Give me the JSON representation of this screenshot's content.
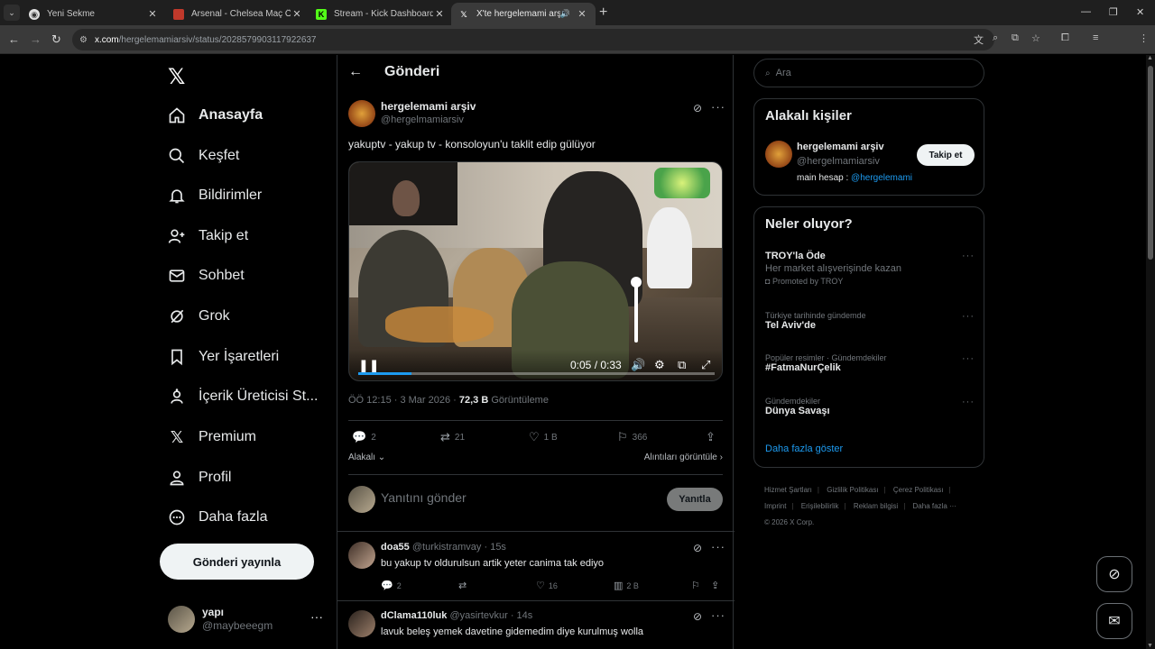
{
  "browser": {
    "tabs": [
      {
        "title": "Yeni Sekme",
        "favicon": "chrome-icon",
        "active": false
      },
      {
        "title": "Arsenal - Chelsea Maç Özeti (Vi",
        "favicon": "video-site-icon",
        "active": false
      },
      {
        "title": "Stream - Kick Dashboard",
        "favicon": "kick-icon",
        "active": false
      },
      {
        "title": "X'te hergelemami arşiv: \"yal",
        "favicon": "x-icon",
        "active": true
      }
    ],
    "url_host": "x.com",
    "url_path": "/hergelemamiarsiv/status/2028579903117922637",
    "profile_color": "#e37400"
  },
  "nav": {
    "items": [
      {
        "label": "Anasayfa",
        "icon": "home-icon"
      },
      {
        "label": "Keşfet",
        "icon": "search-icon"
      },
      {
        "label": "Bildirimler",
        "icon": "bell-icon"
      },
      {
        "label": "Takip et",
        "icon": "person-add-icon"
      },
      {
        "label": "Sohbet",
        "icon": "mail-icon"
      },
      {
        "label": "Grok",
        "icon": "grok-icon"
      },
      {
        "label": "Yer İşaretleri",
        "icon": "bookmark-icon"
      },
      {
        "label": "İçerik Üreticisi St...",
        "icon": "creator-studio-icon"
      },
      {
        "label": "Premium",
        "icon": "x-logo-icon"
      },
      {
        "label": "Profil",
        "icon": "profile-icon"
      },
      {
        "label": "Daha fazla",
        "icon": "more-circle-icon"
      }
    ],
    "post_button": "Gönderi yayınla",
    "account": {
      "name": "yapı",
      "handle": "@maybeeegm"
    }
  },
  "main": {
    "header_title": "Gönderi",
    "post": {
      "author_name": "hergelemami arşiv",
      "author_handle": "@hergelmamiarsiv",
      "text": "yakuptv - yakup tv - konsoloyun'u taklit edip gülüyor",
      "video": {
        "time": "0:05 / 0:33",
        "progress": 0.15,
        "volume": 1.0
      },
      "timestamp": "ÖÖ 12:15 · 3 Mar 2026 · ",
      "views_count": "72,3 B",
      "views_label": "Görüntüleme",
      "replies": "2",
      "reposts": "21",
      "likes": "1 B",
      "bookmarks": "366",
      "related_label": "Alakalı",
      "quotes_label": "Alıntıları görüntüle"
    },
    "reply_box": {
      "placeholder": "Yanıtını gönder",
      "button": "Yanıtla"
    },
    "replies": [
      {
        "name": "doa55",
        "handle": "@turkistramvay · 15s",
        "text": "bu yakup tv oldurulsun artik yeter canima tak ediyo",
        "replies": "2",
        "reposts": "",
        "likes": "16",
        "views": "2 B"
      },
      {
        "name": "dClama110luk",
        "handle": "@yasirtevkur · 14s",
        "text": "lavuk beleş yemek davetine gidemedim diye kurulmuş wolla"
      }
    ]
  },
  "sidebar": {
    "search_placeholder": "Ara",
    "related_title": "Alakalı kişiler",
    "person": {
      "name": "hergelemami arşiv",
      "handle": "@hergelmamiarsiv",
      "bio_prefix": "main hesap : ",
      "bio_link": "@hergelemami",
      "follow_button": "Takip et"
    },
    "trends_title": "Neler oluyor?",
    "trends": [
      {
        "context": "",
        "name": "TROY'la Öde",
        "sub": "Her market alışverişinde kazan",
        "promo": "Promoted by TROY"
      },
      {
        "context": "Türkiye tarihinde gündemde",
        "name": "Tel Aviv'de"
      },
      {
        "context": "Popüler resimler · Gündemdekiler",
        "name": "#FatmaNurÇelik"
      },
      {
        "context": "Gündemdekiler",
        "name": "Dünya Savaşı"
      }
    ],
    "show_more": "Daha fazla göster",
    "footer": [
      "Hizmet Şartları",
      "Gizlilik Politikası",
      "Çerez Politikası",
      "Imprint",
      "Erişilebilirlik",
      "Reklam bilgisi",
      "Daha fazla ···",
      "© 2026 X Corp."
    ]
  },
  "colors": {
    "accent": "#1d9bf0",
    "background": "#000000",
    "border": "#2f3336",
    "muted": "#71767b"
  }
}
